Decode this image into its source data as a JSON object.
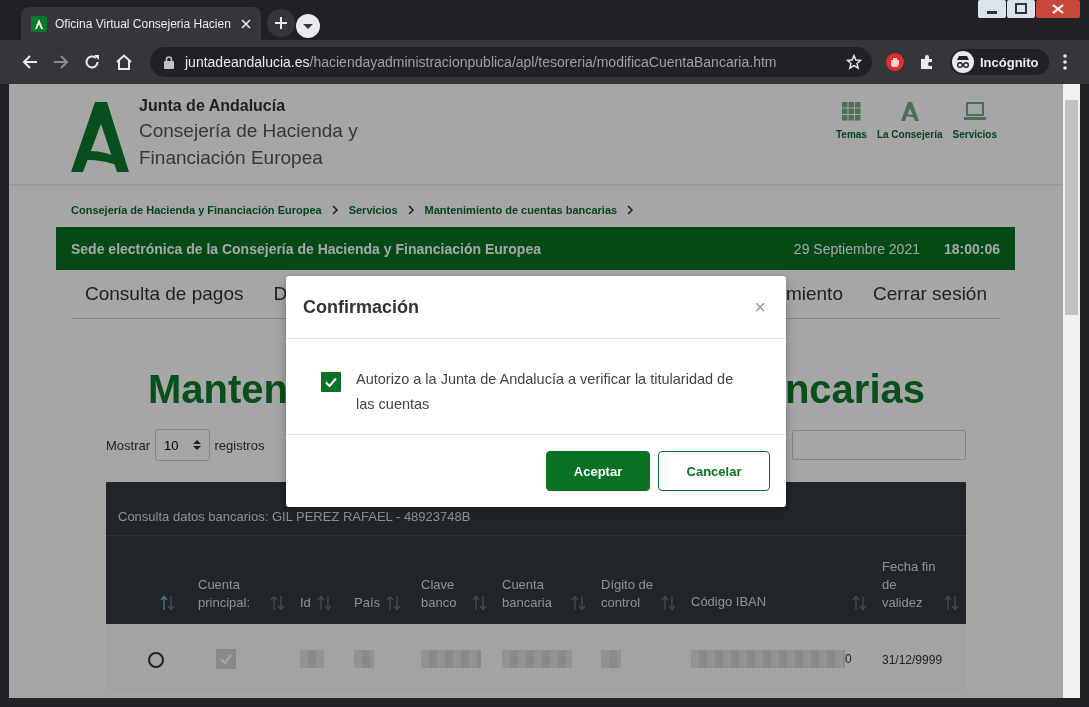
{
  "browser": {
    "tab_title": "Oficina Virtual Consejeria Hacien",
    "url_host": "juntadeandalucia.es",
    "url_path": "/haciendayadministracionpublica/apl/tesoreria/modificaCuentaBancaria.htm",
    "profile_label": "Incógnito"
  },
  "header": {
    "org": "Junta de Andalucía",
    "dept_lines": [
      "Consejería de Hacienda y",
      "Financiación Europea"
    ],
    "links": [
      {
        "label": "Temas",
        "kind": "grid"
      },
      {
        "label": "La Consejería",
        "kind": "logo"
      },
      {
        "label": "Servicios",
        "kind": "laptop"
      }
    ]
  },
  "breadcrumb": [
    "Consejería de Hacienda y Financiación Europea",
    "Servicios",
    "Mantenimiento de cuentas bancarias"
  ],
  "banner": {
    "title": "Sede electrónica de la Consejería de Hacienda y Financiación Europea",
    "date": "29 Septiembre 2021",
    "time": "18:00:06"
  },
  "nav": {
    "left": [
      "Consulta de pagos",
      "D"
    ],
    "right": [
      "miento",
      "Cerrar sesión"
    ]
  },
  "heading": {
    "left": "Manten",
    "right": "ncarias"
  },
  "length_menu": {
    "label_before": "Mostrar",
    "value": "10",
    "label_after": "registros"
  },
  "table": {
    "caption": "Consulta datos bancarios: GIL PEREZ RAFAEL - 48923748B",
    "columns": [
      {
        "sorted": true
      },
      {
        "label": "Cuenta principal:",
        "sorted": false
      },
      {
        "label": "Id",
        "sorted": false
      },
      {
        "label": "País",
        "sorted": false
      },
      {
        "label": "Clave banco",
        "sorted": false
      },
      {
        "label": "Cuenta bancaria",
        "sorted": false
      },
      {
        "label": "Dígito de control",
        "sorted": false
      },
      {
        "label": "Código IBAN",
        "sorted": false
      },
      {
        "label": "Fecha fin de validez",
        "sorted": false
      }
    ],
    "rows": [
      {
        "cells": [
          {
            "kind": "radio",
            "selected": false
          },
          {
            "kind": "checkbox",
            "checked": true
          },
          {
            "kind": "redacted"
          },
          {
            "kind": "redacted"
          },
          {
            "kind": "redacted"
          },
          {
            "kind": "redacted"
          },
          {
            "kind": "redacted"
          },
          {
            "kind": "redacted",
            "tail": "0"
          },
          {
            "kind": "text",
            "text": "31/12/9999"
          }
        ]
      }
    ]
  },
  "modal": {
    "title": "Confirmación",
    "close": "×",
    "checkbox": {
      "label": "Autorizo a la Junta de Andalucía a verificar la titularidad de las cuentas",
      "checked": true
    },
    "buttons": [
      {
        "label": "Aceptar",
        "kind": "primary"
      },
      {
        "label": "Cancelar",
        "kind": "secondary"
      }
    ]
  }
}
